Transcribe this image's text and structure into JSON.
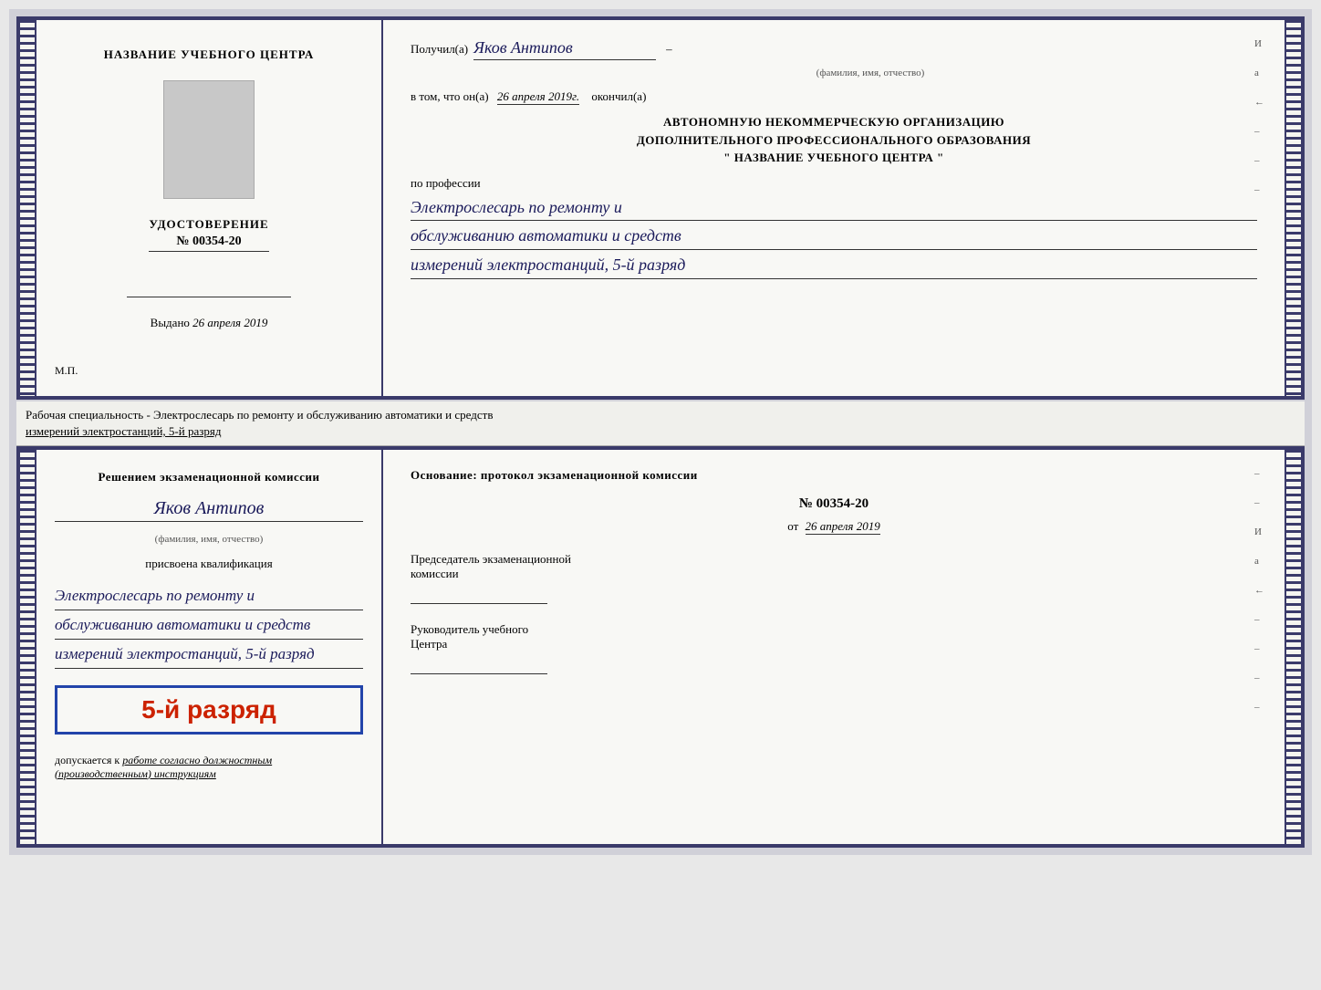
{
  "page": {
    "background_color": "#d0d0d8"
  },
  "top_doc": {
    "left": {
      "center_title": "НАЗВАНИЕ УЧЕБНОГО ЦЕНТРА",
      "udostoverenie_label": "УДОСТОВЕРЕНИЕ",
      "number": "№ 00354-20",
      "vydano_label": "Выдано",
      "vydano_date": "26 апреля 2019",
      "mp_label": "М.П."
    },
    "right": {
      "poluchil_label": "Получил(а)",
      "recipient_name": "Яков Антипов",
      "fio_subtitle": "(фамилия, имя, отчество)",
      "dash": "–",
      "vtom_label": "в том, что он(а)",
      "vtom_date": "26 апреля 2019г.",
      "okonchil_label": "окончил(а)",
      "org_line1": "АВТОНОМНУЮ НЕКОММЕРЧЕСКУЮ ОРГАНИЗАЦИЮ",
      "org_line2": "ДОПОЛНИТЕЛЬНОГО ПРОФЕССИОНАЛЬНОГО ОБРАЗОВАНИЯ",
      "org_line3": "\"  НАЗВАНИЕ УЧЕБНОГО ЦЕНТРА  \"",
      "po_professii_label": "по профессии",
      "profession_line1": "Электрослесарь по ремонту и",
      "profession_line2": "обслуживанию автоматики и средств",
      "profession_line3": "измерений электростанций, 5-й разряд",
      "right_chars": [
        "И",
        "а",
        "←",
        "–",
        "–",
        "–"
      ]
    }
  },
  "middle_strip": {
    "text1": "Рабочая специальность - Электрослесарь по ремонту и обслуживанию автоматики и средств",
    "text2_underline": "измерений электростанций, 5-й разряд"
  },
  "bottom_doc": {
    "left": {
      "resheniem_line1": "Решением  экзаменационной  комиссии",
      "person_name": "Яков Антипов",
      "fio_subtitle": "(фамилия, имя, отчество)",
      "prisvoena_label": "присвоена квалификация",
      "qualification_line1": "Электрослесарь по ремонту и",
      "qualification_line2": "обслуживанию автоматики и средств",
      "qualification_line3": "измерений электростанций, 5-й разряд",
      "razryad_big": "5-й разряд",
      "dopuskaetsya_label": "допускается к",
      "dopuskaetsya_text": "работе согласно должностным",
      "dopuskaetsya_text2": "(производственным) инструкциям"
    },
    "right": {
      "osnovanie_label": "Основание: протокол экзаменационной  комиссии",
      "protocol_number": "№  00354-20",
      "ot_label": "от",
      "ot_date": "26 апреля 2019",
      "predsedatel_line1": "Председатель экзаменационной",
      "predsedatel_line2": "комиссии",
      "rukovoditel_line1": "Руководитель учебного",
      "rukovoditel_line2": "Центра",
      "right_chars": [
        "И",
        "а",
        "←",
        "–",
        "–",
        "–",
        "–"
      ]
    }
  }
}
